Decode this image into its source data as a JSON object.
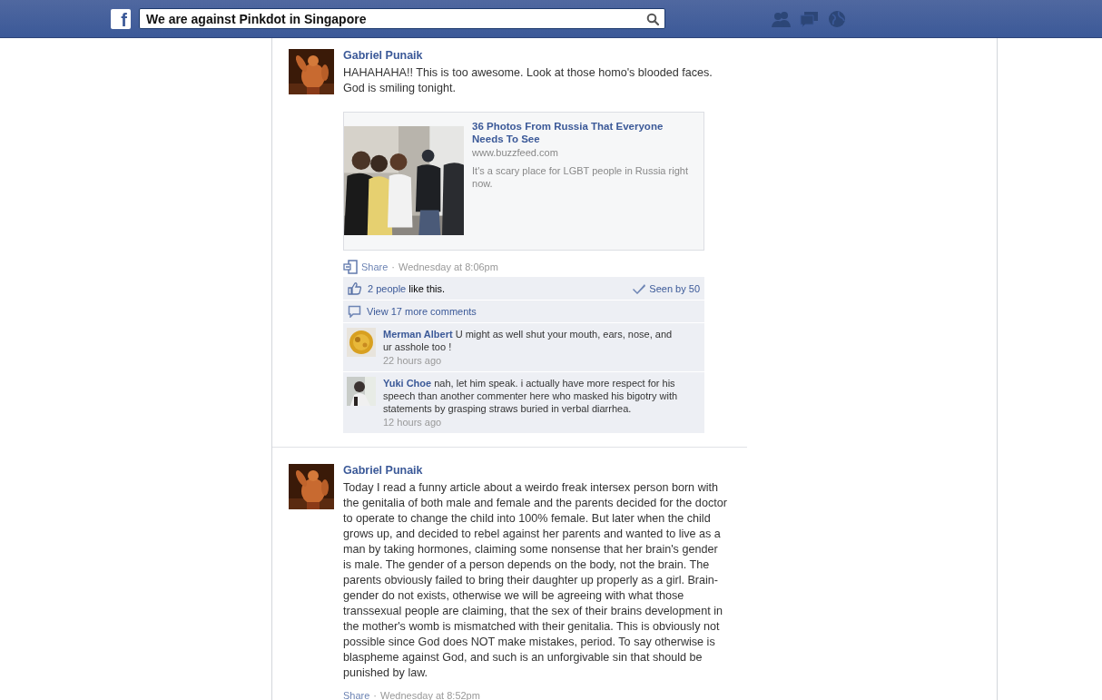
{
  "header": {
    "logo": "f",
    "search": {
      "value": "We are against Pinkdot in Singapore"
    }
  },
  "posts": [
    {
      "author": "Gabriel Punaik",
      "text": "HAHAHAHA!! This is too awesome. Look at those homo's blooded faces. God is smiling tonight.",
      "link": {
        "title": "36 Photos From Russia That Everyone Needs To See",
        "domain": "www.buzzfeed.com",
        "description": "It's a scary place for LGBT people in Russia right now."
      },
      "share": "Share",
      "separator": "·",
      "time": "Wednesday at 8:06pm",
      "likes": {
        "people": "2 people",
        "rest": "like this.",
        "seen": "Seen by 50"
      },
      "more_comments": "View 17 more comments",
      "comments": [
        {
          "author": "Merman Albert",
          "text": "U might as well shut your mouth, ears, nose, and ur asshole too !",
          "time": "22 hours ago"
        },
        {
          "author": "Yuki Choe",
          "text": "nah, let him speak. i actually have more respect for his speech than another commenter here who masked his bigotry with statements by grasping straws buried in verbal diarrhea.",
          "time": "12 hours ago"
        }
      ]
    },
    {
      "author": "Gabriel Punaik",
      "text": "Today I read a funny article about a weirdo freak intersex person born with the genitalia of both male and female and the parents decided for the doctor to operate to change the child into 100% female. But later when the child grows up, and decided to rebel against her parents and wanted to live as a man by taking hormones, claiming some nonsense that her brain's gender is male. The gender of a person depends on the body, not the brain. The parents obviously failed to bring their daughter up properly as a girl. Brain-gender do not exists, otherwise we will be agreeing with what those transsexual people are claiming, that the sex of their brains development in the mother's womb is mismatched with their genitalia. This is obviously not possible since God does NOT make mistakes, period. To say otherwise is blaspheme against God, and such is an unforgivable sin that should be punished by law.",
      "share": "Share",
      "separator": "·",
      "time": "Wednesday at 8:52pm"
    }
  ]
}
